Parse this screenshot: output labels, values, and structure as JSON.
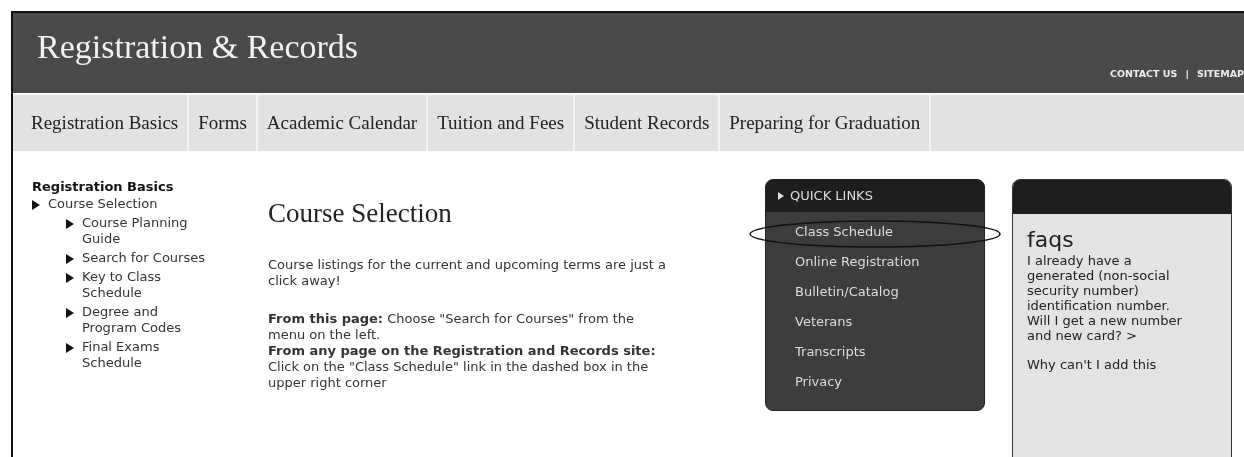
{
  "header": {
    "title": "Registration & Records",
    "utility_links": [
      "CONTACT US",
      "SITEMAP"
    ],
    "separator": "|"
  },
  "nav": {
    "items": [
      "Registration Basics",
      "Forms",
      "Academic Calendar",
      "Tuition and Fees",
      "Student Records",
      "Preparing for Graduation"
    ]
  },
  "sidebar": {
    "heading": "Registration Basics",
    "items": [
      {
        "label": "Course Selection",
        "children": [
          {
            "label": "Course Planning Guide"
          },
          {
            "label": "Search for Courses"
          },
          {
            "label": "Key to Class Schedule"
          },
          {
            "label": "Degree and Program Codes"
          },
          {
            "label": "Final Exams Schedule"
          }
        ]
      }
    ]
  },
  "main": {
    "heading": "Course Selection",
    "paragraphs": [
      "Course listings for the current and upcoming terms are just a click away!",
      "**From this page:** Choose \"Search for Courses\" from the menu on the left.\n**From any page on the Registration and Records site:** Click on the \"Class Schedule\" link in the dashed box in the upper right corner"
    ]
  },
  "quick_links": {
    "title": "QUICK LINKS",
    "items": [
      {
        "label": "Class Schedule",
        "circled": true
      },
      {
        "label": "Online Registration",
        "circled": false
      },
      {
        "label": "Bulletin/Catalog",
        "circled": false
      },
      {
        "label": "Veterans",
        "circled": false
      },
      {
        "label": "Transcripts",
        "circled": false
      },
      {
        "label": "Privacy",
        "circled": false
      }
    ]
  },
  "faqs": {
    "title": "faqs",
    "questions": [
      "I already have a generated (non-social security number) identification number. Will I get a new number and new card? >",
      "Why can't I add this"
    ]
  }
}
